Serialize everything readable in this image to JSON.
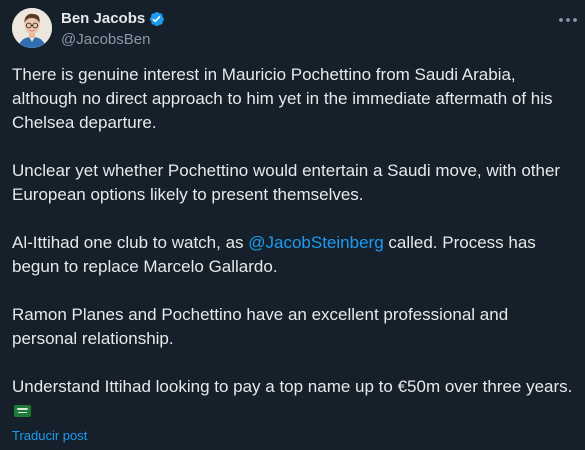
{
  "tweet": {
    "author": {
      "display_name": "Ben Jacobs",
      "handle": "@JacobsBen",
      "verified": true
    },
    "paragraphs": [
      "There is genuine interest in Mauricio Pochettino from Saudi Arabia, although no direct approach to him yet in the immediate aftermath of his Chelsea departure.",
      "Unclear yet whether Pochettino would entertain a Saudi move, with other European options likely to present themselves."
    ],
    "para3": {
      "before": "Al-Ittihad one club to watch, as ",
      "mention": "@JacobSteinberg",
      "after": " called. Process has begun to replace Marcelo Gallardo."
    },
    "para4": "Ramon Planes and Pochettino have an excellent professional and personal relationship.",
    "para5": "Understand Ittihad looking to pay a top name up to €50m over three years.",
    "translate_label": "Traducir post",
    "icons": {
      "verified": "verified-badge-icon",
      "more": "more-horizontal-icon",
      "flag": "saudi-flag-emoji"
    },
    "colors": {
      "background": "#15202b",
      "text": "#e7e9ea",
      "secondary": "#8b98a5",
      "accent": "#1d9bf0"
    }
  }
}
